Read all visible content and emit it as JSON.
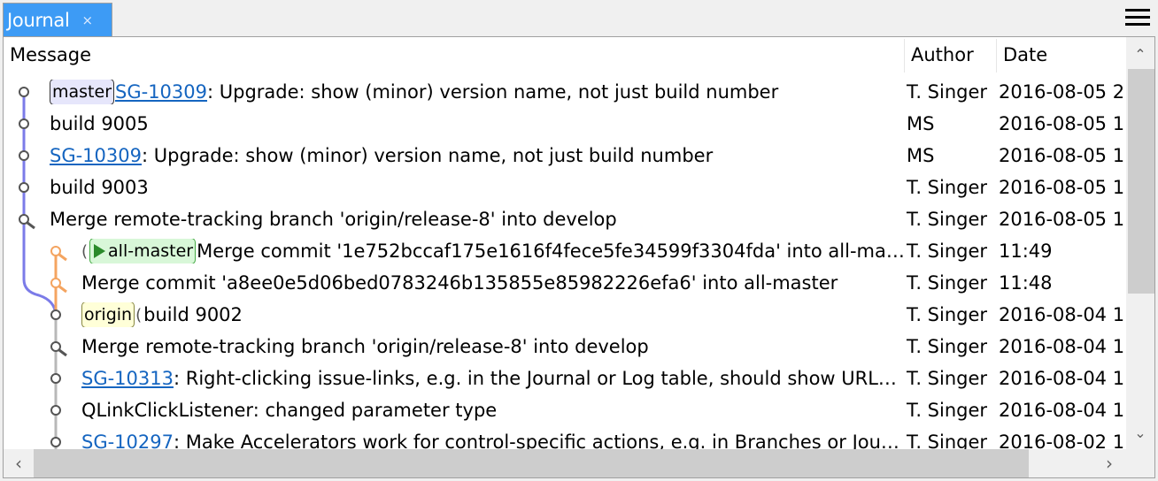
{
  "tab": {
    "label": "Journal",
    "close": "×"
  },
  "menu_icon": "hamburger-menu-icon",
  "columns": {
    "message": "Message",
    "author": "Author",
    "date": "Date"
  },
  "colors": {
    "tab_active": "#3d9bf5",
    "graph_main": "#7b7be8",
    "graph_branch": "#f4a460",
    "graph_grey": "#b8b8b8",
    "link": "#1565c0"
  },
  "rows": [
    {
      "badge": "master",
      "badge_type": "master",
      "link": "SG-10309",
      "text": ": Upgrade: show (minor) version name, not just build number",
      "author": "T. Singer",
      "date": "2016-08-05 2",
      "node": "commit",
      "indent": 0
    },
    {
      "badge": "",
      "link": "",
      "text": "build 9005",
      "author": "MS",
      "date": "2016-08-05 1",
      "node": "commit",
      "indent": 0
    },
    {
      "badge": "",
      "link": "SG-10309",
      "text": ": Upgrade: show (minor) version name, not just build number",
      "author": "MS",
      "date": "2016-08-05 1",
      "node": "commit",
      "indent": 0
    },
    {
      "badge": "",
      "link": "",
      "text": "build 9003",
      "author": "T. Singer",
      "date": "2016-08-05 1",
      "node": "commit",
      "indent": 0
    },
    {
      "badge": "",
      "link": "",
      "text": "Merge remote-tracking branch 'origin/release-8' into develop",
      "author": "T. Singer",
      "date": "2016-08-05 1",
      "node": "merge",
      "indent": 0
    },
    {
      "badge": "all-master",
      "badge_type": "allmaster",
      "link": "",
      "text": "Merge commit '1e752bccaf175e1616f4fece5fe34599f3304fda' into all-ma…",
      "author": "T. Singer",
      "date": "11:49",
      "node": "merge",
      "indent": 1
    },
    {
      "badge": "",
      "link": "",
      "text": "Merge commit 'a8ee0e5d06bed0783246b135855e85982226efa6' into all-master",
      "author": "T. Singer",
      "date": "11:48",
      "node": "merge",
      "indent": 1
    },
    {
      "badge": "origin",
      "badge_type": "origin",
      "link": "",
      "text": "build 9002",
      "author": "T. Singer",
      "date": "2016-08-04 1",
      "node": "commit",
      "indent": 1
    },
    {
      "badge": "",
      "link": "",
      "text": "Merge remote-tracking branch 'origin/release-8' into develop",
      "author": "T. Singer",
      "date": "2016-08-04 1",
      "node": "merge",
      "indent": 1
    },
    {
      "badge": "",
      "link": "SG-10313",
      "text": ": Right-clicking issue-links, e.g. in the Journal or Log table, should show URL…",
      "author": "T. Singer",
      "date": "2016-08-04 1",
      "node": "commit",
      "indent": 1
    },
    {
      "badge": "",
      "link": "",
      "text": "QLinkClickListener: changed parameter type",
      "author": "T. Singer",
      "date": "2016-08-04 1",
      "node": "commit",
      "indent": 1
    },
    {
      "badge": "",
      "link": "SG-10297",
      "text": ": Make Accelerators work for control-specific actions, e.g. in Branches or Jou…",
      "author": "T. Singer",
      "date": "2016-08-02 1",
      "node": "commit",
      "indent": 1
    }
  ],
  "scroll": {
    "up": "^",
    "down": "v",
    "left": "<",
    "right": ">"
  }
}
